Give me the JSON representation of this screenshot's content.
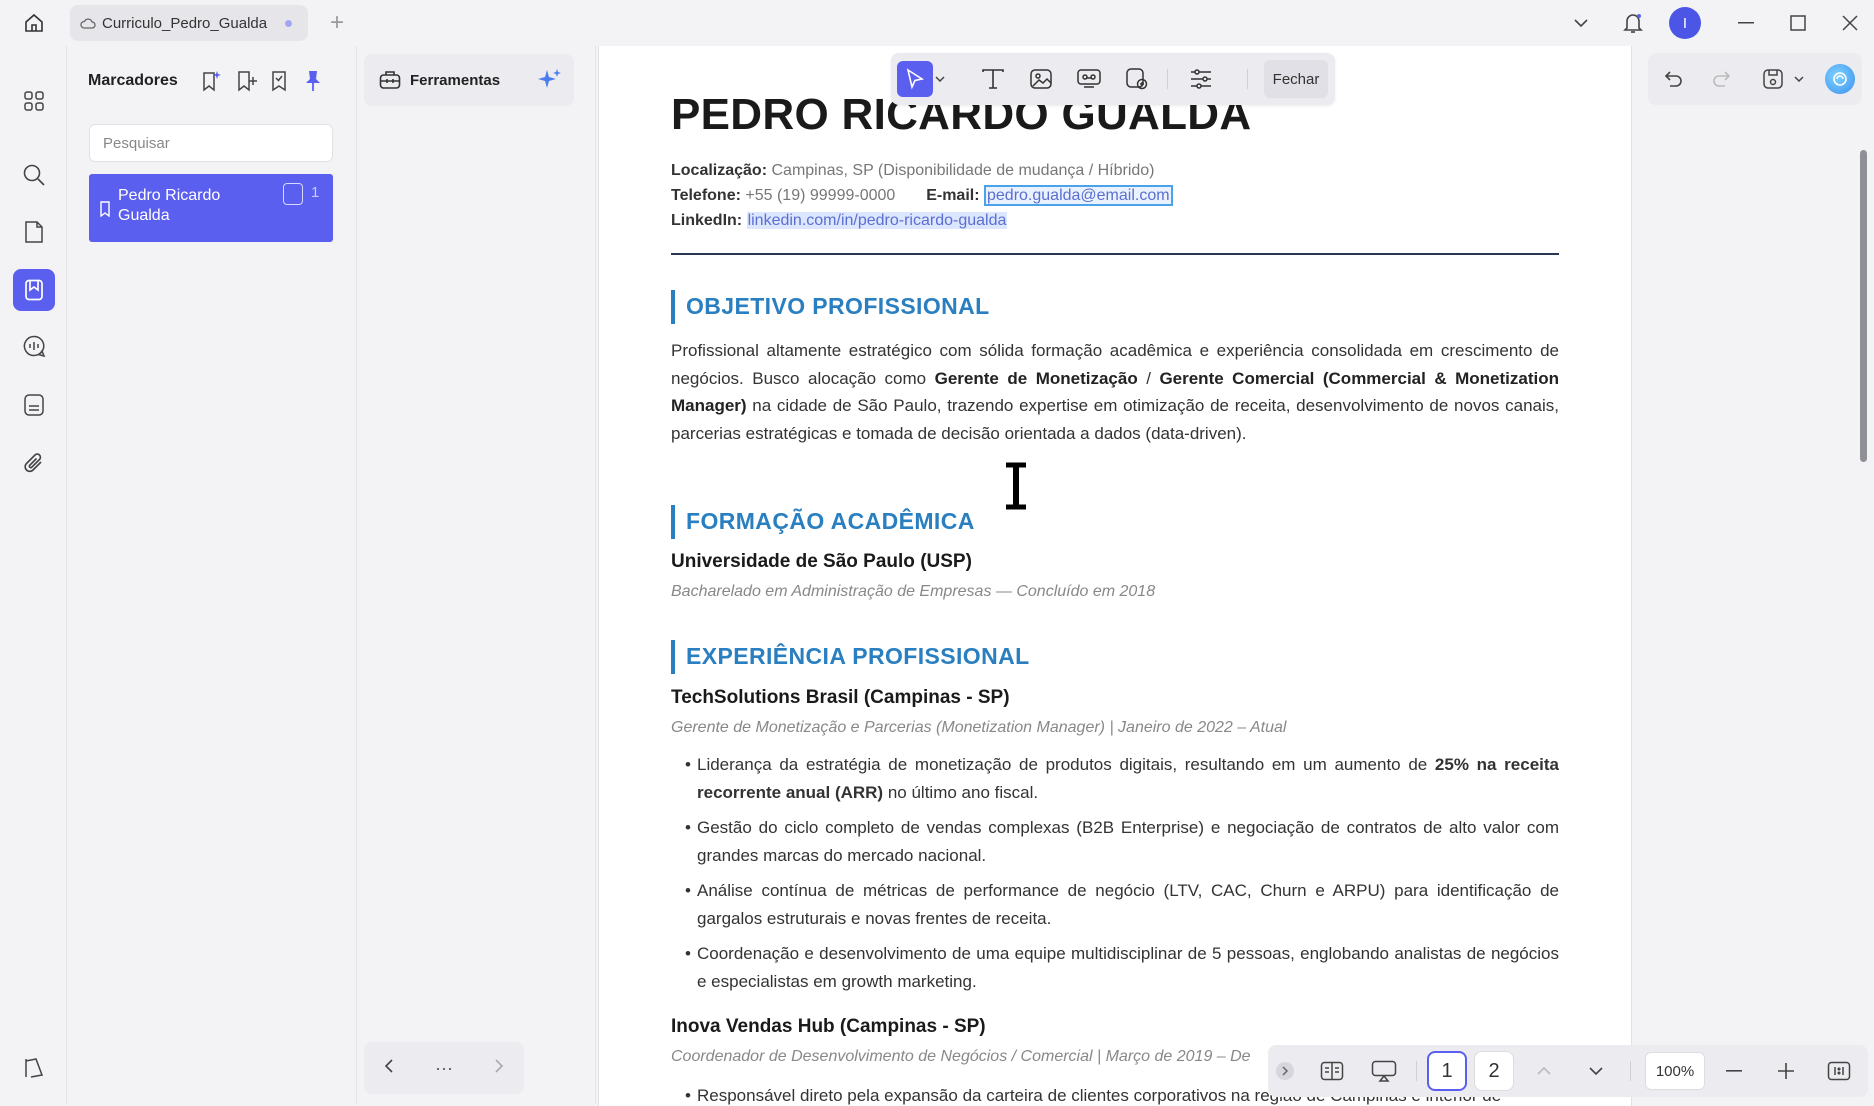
{
  "window": {
    "tab_title": "Curriculo_Pedro_Gualda",
    "avatar_letter": "I"
  },
  "bookmarks": {
    "title": "Marcadores",
    "search_placeholder": "Pesquisar",
    "items": [
      {
        "label": "Pedro Ricardo Gualda",
        "page": "1"
      }
    ]
  },
  "tools": {
    "title": "Ferramentas",
    "nav_more": "···"
  },
  "toolbar": {
    "close_label": "Fechar"
  },
  "document": {
    "name": "PEDRO RICARDO GUALDA",
    "location_label": "Localização:",
    "location_value": "Campinas, SP (Disponibilidade de mudança / Híbrido)",
    "phone_label": "Telefone:",
    "phone_value": "+55 (19) 99999-0000",
    "email_label": "E-mail:",
    "email_value": "pedro.gualda@email.com",
    "linkedin_label": "LinkedIn:",
    "linkedin_value": "linkedin.com/in/pedro-ricardo-gualda",
    "sections": {
      "objective": "OBJETIVO PROFISSIONAL",
      "education": "FORMAÇÃO ACADÊMICA",
      "experience": "EXPERIÊNCIA PROFISSIONAL"
    },
    "objective": {
      "p1": "Profissional altamente estratégico com sólida formação acadêmica e experiência consolidada em crescimento de negócios. Busco alocação como ",
      "b1": "Gerente de Monetização",
      "p2": " / ",
      "b2": "Gerente Comercial (Commercial & Monetization Manager)",
      "p3": " na cidade de São Paulo, trazendo expertise em otimização de receita, desenvolvimento de novos canais, parcerias estratégicas e tomada de decisão orientada a dados (data-driven)."
    },
    "education": {
      "school": "Universidade de São Paulo (USP)",
      "degree": "Bacharelado em Administração de Empresas — Concluído em 2018"
    },
    "experience": [
      {
        "company": "TechSolutions Brasil (Campinas - SP)",
        "role": "Gerente de Monetização e Parcerias (Monetization Manager) | Janeiro de 2022 – Atual",
        "bullet1_a": "Liderança da estratégia de monetização de produtos digitais, resultando em um aumento de ",
        "bullet1_b": "25% na receita recorrente anual (ARR)",
        "bullet1_c": " no último ano fiscal.",
        "bullet2": "Gestão do ciclo completo de vendas complexas (B2B Enterprise) e negociação de contratos de alto valor com grandes marcas do mercado nacional.",
        "bullet3": "Análise contínua de métricas de performance de negócio (LTV, CAC, Churn e ARPU) para identificação de gargalos estruturais e novas frentes de receita.",
        "bullet4": "Coordenação e desenvolvimento de uma equipe multidisciplinar de 5 pessoas, englobando analistas de negócios e especialistas em growth marketing."
      },
      {
        "company": "Inova Vendas Hub (Campinas - SP)",
        "role": "Coordenador de Desenvolvimento de Negócios / Comercial | Março de 2019 – De",
        "bullet1": "Responsável direto pela expansão da carteira de clientes corporativos na região de Campinas e interior de"
      }
    ]
  },
  "pagination": {
    "pages": [
      "1",
      "2"
    ],
    "current": "1",
    "zoom": "100%"
  },
  "colors": {
    "accent": "#5b5ff0",
    "heading_blue": "#2a7fc0"
  }
}
